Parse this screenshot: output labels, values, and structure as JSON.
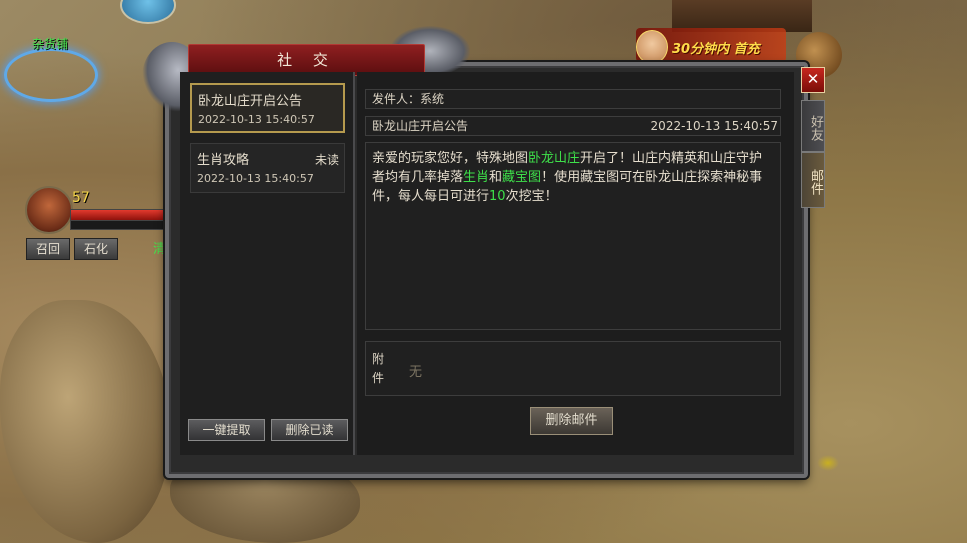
{
  "hud": {
    "npc_name": "杂货铺",
    "level": "57",
    "hp_fraction": 1.0,
    "buttons": {
      "recall": "召回",
      "stone": "石化"
    },
    "green_char": "清",
    "promo_title": "30分钟内 首充"
  },
  "window": {
    "title": "社 交",
    "close_label": "✕",
    "tabs": {
      "friends": "好友",
      "mail": "邮件"
    }
  },
  "mail_list": {
    "items": [
      {
        "subject": "卧龙山庄开启公告",
        "date": "2022-10-13 15:40:57",
        "status": ""
      },
      {
        "subject": "生肖攻略",
        "date": "2022-10-13 15:40:57",
        "status": "未读"
      }
    ],
    "claim_all": "一键提取",
    "delete_read": "删除已读"
  },
  "mail_detail": {
    "sender": "发件人：系统",
    "title": "卧龙山庄开启公告",
    "date": "2022-10-13 15:40:57",
    "body": {
      "p1": "亲爱的玩家您好，特殊地图",
      "hl1": "卧龙山庄",
      "p2": "开启了！山庄内精英和山庄守护者均有几率掉落",
      "hl2": "生肖",
      "p3": "和",
      "hl3": "藏宝图",
      "p4": "！使用藏宝图可在卧龙山庄探索神秘事件，每人每日可进行",
      "hl4": "10",
      "p5": "次挖宝！"
    },
    "attachment_label": "附件",
    "attachment_value": "无",
    "delete_button": "删除邮件"
  },
  "colors": {
    "highlight": "#3ee04a",
    "title_bar": "#8f1f20",
    "selected_border": "#b59a4e"
  }
}
